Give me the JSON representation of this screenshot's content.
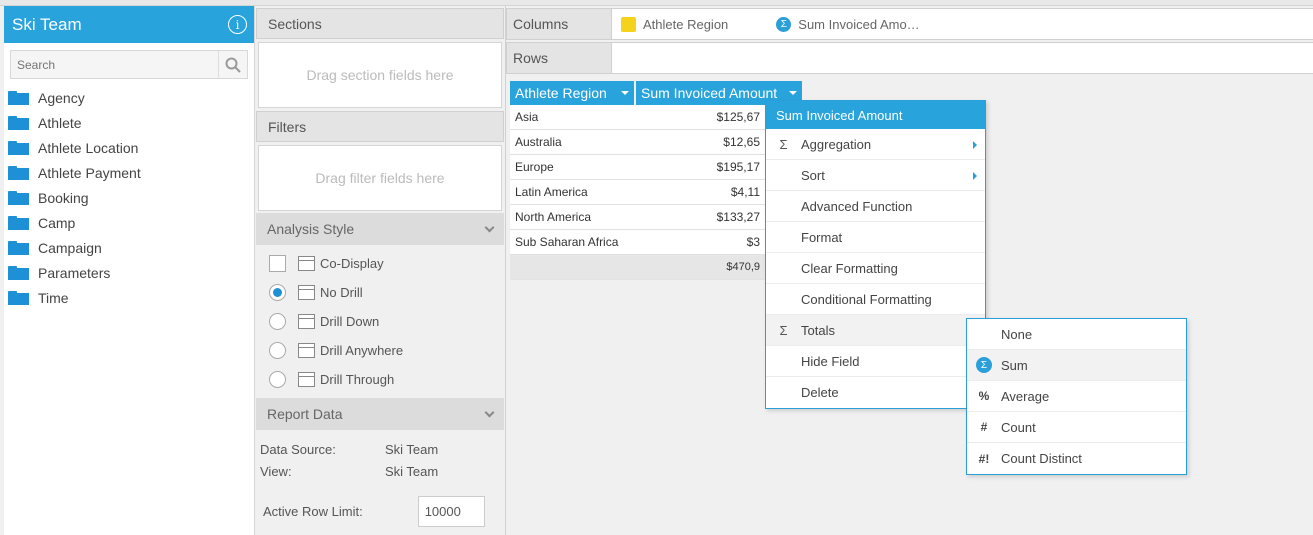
{
  "left_panel": {
    "title": "Ski Team",
    "search_placeholder": "Search",
    "folders": [
      "Agency",
      "Athlete",
      "Athlete Location",
      "Athlete Payment",
      "Booking",
      "Camp",
      "Campaign",
      "Parameters",
      "Time"
    ]
  },
  "middle_panel": {
    "sections_title": "Sections",
    "sections_placeholder": "Drag section fields here",
    "filters_title": "Filters",
    "filters_placeholder": "Drag filter fields here",
    "analysis_style_title": "Analysis Style",
    "styles": [
      {
        "label": "Co-Display",
        "control": "checkbox",
        "selected": false
      },
      {
        "label": "No Drill",
        "control": "radio",
        "selected": true
      },
      {
        "label": "Drill Down",
        "control": "radio",
        "selected": false
      },
      {
        "label": "Drill Anywhere",
        "control": "radio",
        "selected": false
      },
      {
        "label": "Drill Through",
        "control": "radio",
        "selected": false
      }
    ],
    "report_data_title": "Report Data",
    "data_source_label": "Data Source:",
    "data_source_value": "Ski Team",
    "view_label": "View:",
    "view_value": "Ski Team",
    "row_limit_label": "Active Row Limit:",
    "row_limit_value": "10000"
  },
  "shelves": {
    "columns_label": "Columns",
    "columns_fields": [
      "Athlete Region",
      "Sum Invoiced Amo…"
    ],
    "rows_label": "Rows"
  },
  "table": {
    "headers": [
      "Athlete Region",
      "Sum Invoiced Amount"
    ],
    "rows": [
      [
        "Asia",
        "$125,67"
      ],
      [
        "Australia",
        "$12,65"
      ],
      [
        "Europe",
        "$195,17"
      ],
      [
        "Latin America",
        "$4,11"
      ],
      [
        "North America",
        "$133,27"
      ],
      [
        "Sub Saharan Africa",
        "$3"
      ]
    ],
    "total": "$470,9"
  },
  "context_menu": {
    "title": "Sum Invoiced Amount",
    "items": [
      {
        "label": "Aggregation",
        "icon": "Σ",
        "submenu": true
      },
      {
        "label": "Sort",
        "icon": "",
        "submenu": true
      },
      {
        "label": "Advanced Function",
        "icon": "",
        "submenu": false
      },
      {
        "label": "Format",
        "icon": "",
        "submenu": false
      },
      {
        "label": "Clear Formatting",
        "icon": "",
        "submenu": false
      },
      {
        "label": "Conditional Formatting",
        "icon": "",
        "submenu": false
      },
      {
        "label": "Totals",
        "icon": "Σ",
        "submenu": false
      },
      {
        "label": "Hide Field",
        "icon": "",
        "submenu": false
      },
      {
        "label": "Delete",
        "icon": "",
        "submenu": false
      }
    ]
  },
  "totals_submenu": {
    "items": [
      {
        "label": "None",
        "icon": ""
      },
      {
        "label": "Sum",
        "icon": "Σ"
      },
      {
        "label": "Average",
        "icon": "%"
      },
      {
        "label": "Count",
        "icon": "#"
      },
      {
        "label": "Count Distinct",
        "icon": "#!"
      }
    ]
  },
  "colors": {
    "accent": "#29a3dc",
    "chip_yellow": "#f5d31c"
  }
}
